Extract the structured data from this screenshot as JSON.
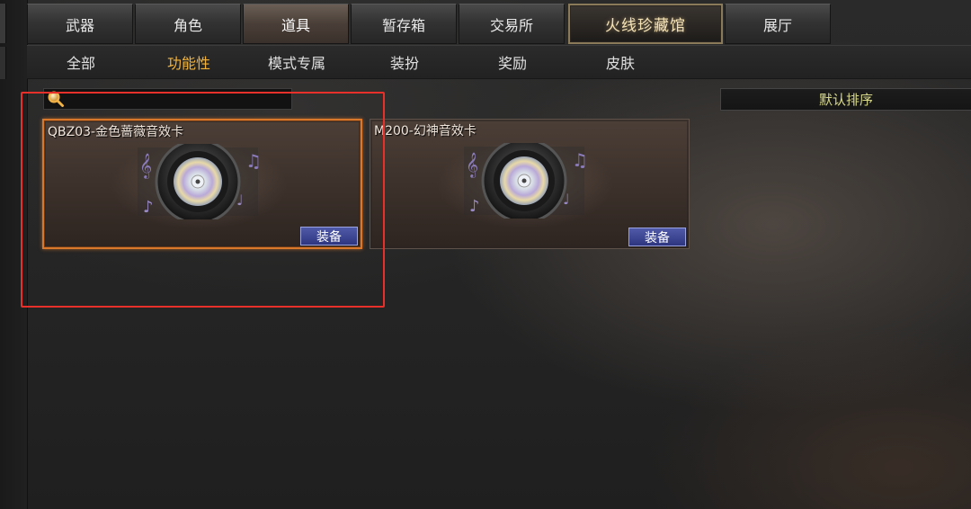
{
  "main_tabs": [
    {
      "label": "武器"
    },
    {
      "label": "角色"
    },
    {
      "label": "道具"
    },
    {
      "label": "暂存箱"
    },
    {
      "label": "交易所"
    },
    {
      "label": "火线珍藏馆"
    },
    {
      "label": "展厅"
    }
  ],
  "active_main_tab": "道具",
  "sub_tabs": [
    {
      "label": "全部"
    },
    {
      "label": "功能性"
    },
    {
      "label": "模式专属"
    },
    {
      "label": "装扮"
    },
    {
      "label": "奖励"
    },
    {
      "label": "皮肤"
    }
  ],
  "active_sub_tab": "功能性",
  "search": {
    "value": "",
    "placeholder": "",
    "icon": "search-icon"
  },
  "sort": {
    "label": "默认排序"
  },
  "items": [
    {
      "name": "QBZ03-金色蔷薇音效卡",
      "button": "装备",
      "icon": "music-disc-icon",
      "selected": true
    },
    {
      "name": "M200-幻神音效卡",
      "button": "装备",
      "icon": "music-disc-icon",
      "selected": false
    }
  ],
  "colors": {
    "active_subtab": "#f3b33a",
    "highlight": "#e8302a",
    "selected_border": "#d9782a",
    "equip_button": "#3a4290",
    "sort_text": "#d8d98a"
  }
}
